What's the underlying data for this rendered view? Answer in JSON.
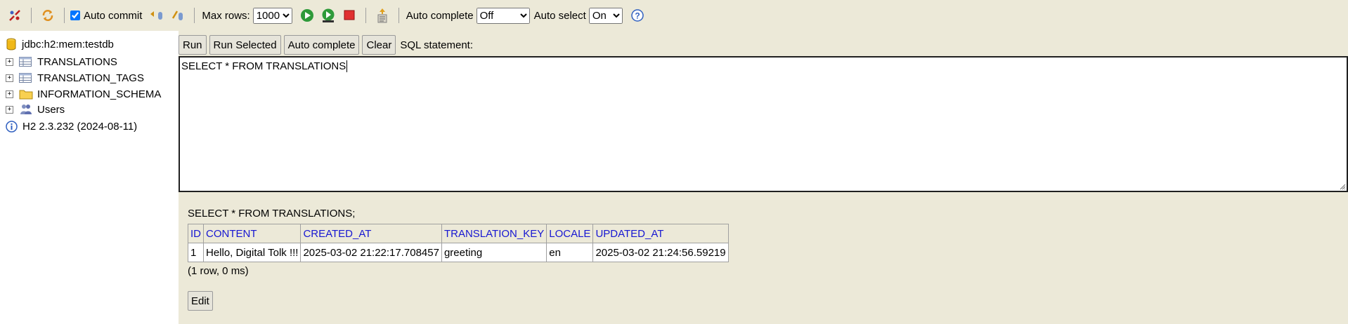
{
  "toolbar": {
    "auto_commit_label": "Auto commit",
    "auto_commit_checked": true,
    "max_rows_label": "Max rows:",
    "max_rows_value": "1000",
    "auto_complete_label": "Auto complete",
    "auto_complete_value": "Off",
    "auto_select_label": "Auto select",
    "auto_select_value": "On"
  },
  "tree": {
    "connection": "jdbc:h2:mem:testdb",
    "items": [
      {
        "label": "TRANSLATIONS"
      },
      {
        "label": "TRANSLATION_TAGS"
      },
      {
        "label": "INFORMATION_SCHEMA"
      },
      {
        "label": "Users"
      }
    ],
    "version": "H2 2.3.232 (2024-08-11)"
  },
  "editor": {
    "buttons": {
      "run": "Run",
      "run_selected": "Run Selected",
      "auto_complete": "Auto complete",
      "clear": "Clear"
    },
    "sql_label": "SQL statement:",
    "sql_text": "SELECT * FROM TRANSLATIONS"
  },
  "result": {
    "query": "SELECT * FROM TRANSLATIONS;",
    "columns": [
      "ID",
      "CONTENT",
      "CREATED_AT",
      "TRANSLATION_KEY",
      "LOCALE",
      "UPDATED_AT"
    ],
    "rows": [
      [
        "1",
        "Hello, Digital Tolk !!!",
        "2025-03-02 21:22:17.708457",
        "greeting",
        "en",
        "2025-03-02 21:24:56.59219"
      ]
    ],
    "summary": "(1 row, 0 ms)",
    "edit_label": "Edit"
  }
}
